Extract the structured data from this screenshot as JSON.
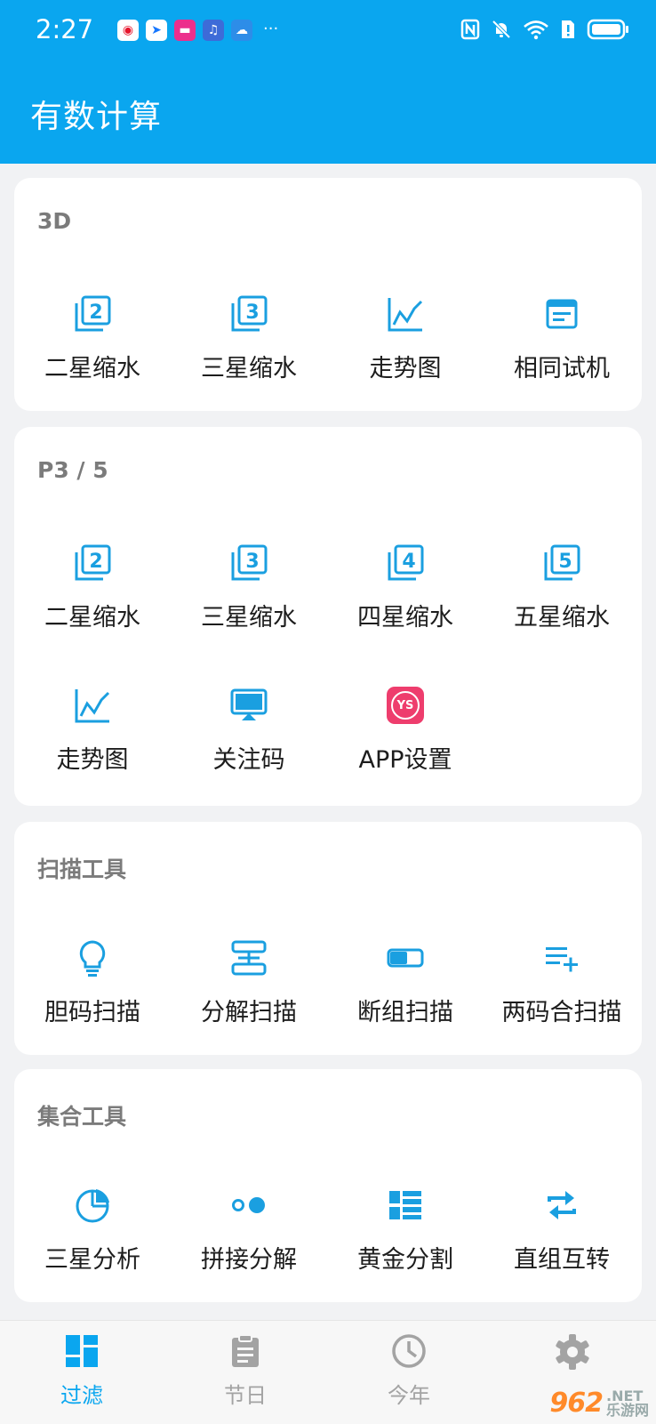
{
  "status": {
    "time": "2:27",
    "more": "···"
  },
  "app_title": "有数计算",
  "sections": [
    {
      "title": "3D",
      "items": [
        {
          "label": "二星缩水",
          "icon": "copy-2-icon"
        },
        {
          "label": "三星缩水",
          "icon": "copy-3-icon"
        },
        {
          "label": "走势图",
          "icon": "trend-chart-icon"
        },
        {
          "label": "相同试机",
          "icon": "document-list-icon"
        }
      ]
    },
    {
      "title": "P3 / 5",
      "items": [
        {
          "label": "二星缩水",
          "icon": "copy-2-icon"
        },
        {
          "label": "三星缩水",
          "icon": "copy-3-icon"
        },
        {
          "label": "四星缩水",
          "icon": "copy-4-icon"
        },
        {
          "label": "五星缩水",
          "icon": "copy-5-icon"
        },
        {
          "label": "走势图",
          "icon": "trend-chart-icon"
        },
        {
          "label": "关注码",
          "icon": "monitor-icon"
        },
        {
          "label": "APP设置",
          "icon": "ys-logo-icon",
          "badge": "YS"
        }
      ]
    },
    {
      "title": "扫描工具",
      "items": [
        {
          "label": "胆码扫描",
          "icon": "lightbulb-icon"
        },
        {
          "label": "分解扫描",
          "icon": "split-stack-icon"
        },
        {
          "label": "断组扫描",
          "icon": "toggle-block-icon"
        },
        {
          "label": "两码合扫描",
          "icon": "playlist-add-icon"
        }
      ]
    },
    {
      "title": "集合工具",
      "items": [
        {
          "label": "三星分析",
          "icon": "pie-chart-icon"
        },
        {
          "label": "拼接分解",
          "icon": "dots-icon"
        },
        {
          "label": "黄金分割",
          "icon": "grid-list-icon"
        },
        {
          "label": "直组互转",
          "icon": "swap-arrows-icon"
        }
      ]
    }
  ],
  "nav": [
    {
      "label": "过滤",
      "icon": "dashboard-icon",
      "active": true
    },
    {
      "label": "节日",
      "icon": "clipboard-icon"
    },
    {
      "label": "今年",
      "icon": "clock-icon"
    },
    {
      "label": "",
      "icon": "gear-icon"
    }
  ],
  "watermark": {
    "logo": "962",
    "net": ".NET",
    "sub": "乐游网"
  },
  "colors": {
    "primary": "#0aa6ef",
    "icon": "#1a9fe0",
    "badge": "#ee3d6d"
  }
}
